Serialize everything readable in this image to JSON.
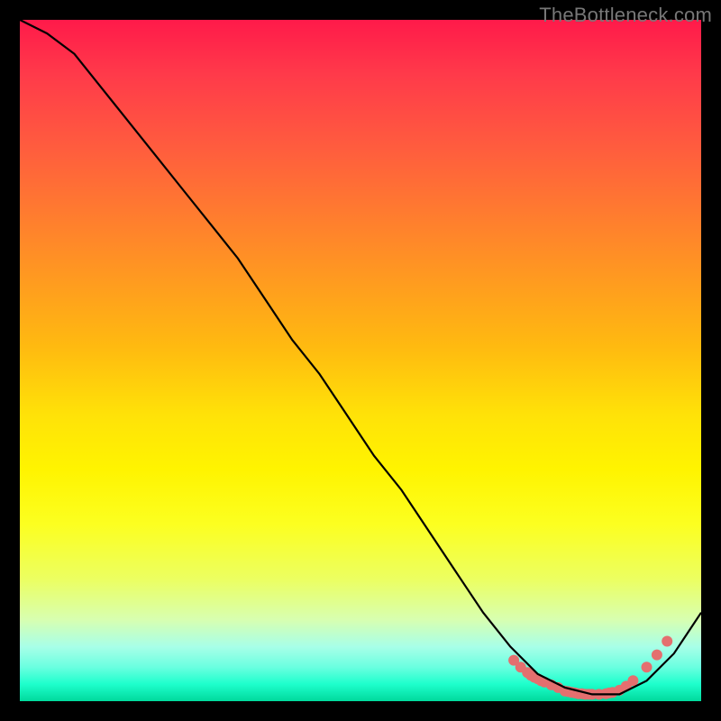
{
  "watermark": "TheBottleneck.com",
  "chart_data": {
    "type": "line",
    "title": "",
    "xlabel": "",
    "ylabel": "",
    "xlim": [
      0,
      100
    ],
    "ylim": [
      0,
      100
    ],
    "series": [
      {
        "name": "curve",
        "color": "#000000",
        "x": [
          0,
          4,
          8,
          12,
          16,
          20,
          24,
          28,
          32,
          36,
          40,
          44,
          48,
          52,
          56,
          60,
          64,
          68,
          72,
          76,
          80,
          84,
          88,
          92,
          96,
          100
        ],
        "y": [
          100,
          98,
          95,
          90,
          85,
          80,
          75,
          70,
          65,
          59,
          53,
          48,
          42,
          36,
          31,
          25,
          19,
          13,
          8,
          4,
          2,
          1,
          1,
          3,
          7,
          13
        ]
      }
    ],
    "markers": {
      "name": "marker-cluster",
      "color": "#e46f6f",
      "x": [
        72.5,
        73.5,
        74.5,
        75.0,
        75.5,
        76.0,
        76.5,
        77.0,
        78.0,
        79.0,
        80.0,
        80.5,
        81.0,
        81.5,
        82.0,
        82.5,
        83.0,
        83.5,
        84.0,
        85.0,
        86.0,
        86.5,
        87.0,
        88.0,
        89.0,
        90.0,
        92.0,
        93.5,
        95.0
      ],
      "y": [
        6.0,
        5.0,
        4.2,
        3.8,
        3.5,
        3.3,
        3.0,
        2.8,
        2.4,
        2.0,
        1.5,
        1.4,
        1.3,
        1.2,
        1.1,
        1.1,
        1.0,
        1.0,
        1.0,
        1.0,
        1.1,
        1.2,
        1.3,
        1.6,
        2.2,
        3.0,
        5.0,
        6.8,
        8.8
      ]
    }
  }
}
